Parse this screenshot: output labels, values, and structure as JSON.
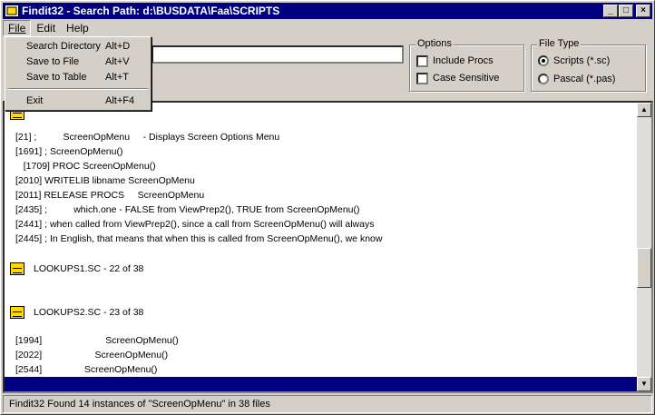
{
  "window": {
    "title": "Findit32 - Search Path: d:\\BUSDATA\\Faa\\SCRIPTS",
    "controls": {
      "minimize": "_",
      "maximize": "□",
      "close": "×"
    }
  },
  "menubar": {
    "file": "File",
    "edit": "Edit",
    "help": "Help"
  },
  "file_menu": [
    {
      "label": "Search Directory",
      "shortcut": "Alt+D"
    },
    {
      "label": "Save to File",
      "shortcut": "Alt+V"
    },
    {
      "label": "Save to Table",
      "shortcut": "Alt+T"
    },
    {
      "label": "Exit",
      "shortcut": "Alt+F4"
    }
  ],
  "search": {
    "value": ""
  },
  "options": {
    "title": "Options",
    "include_procs": {
      "label": "Include Procs",
      "checked": false
    },
    "case_sensitive": {
      "label": "Case Sensitive",
      "checked": false
    }
  },
  "file_type": {
    "title": "File Type",
    "scripts": {
      "label": "Scripts (*.sc)",
      "selected": true
    },
    "pascal": {
      "label": "Pascal (*.pas)",
      "selected": false
    }
  },
  "results": {
    "lines1": [
      "[21] ;          ScreenOpMenu     - Displays Screen Options Menu",
      "[1691] ; ScreenOpMenu()",
      "   [1709] PROC ScreenOpMenu()",
      "[2010] WRITELIB libname ScreenOpMenu",
      "[2011] RELEASE PROCS     ScreenOpMenu",
      "[2435] ;          which.one - FALSE from ViewPrep2(), TRUE from ScreenOpMenu()",
      "[2441] ; when called from ViewPrep2(), since a call from ScreenOpMenu() will always",
      "[2445] ; In English, that means that when this is called from ScreenOpMenu(), we know"
    ],
    "file1": "LOOKUPS1.SC - 22 of 38",
    "file2": "LOOKUPS2.SC - 23 of 38",
    "lines2": [
      "[1994]                        ScreenOpMenu()",
      "[2022]                    ScreenOpMenu()",
      "[2544]                ScreenOpMenu()"
    ]
  },
  "status": "Findit32 Found 14 instances of \"ScreenOpMenu\" in 38 files",
  "icons": [
    "app-icon",
    "file-icon",
    "scroll-up-icon",
    "scroll-down-icon"
  ]
}
